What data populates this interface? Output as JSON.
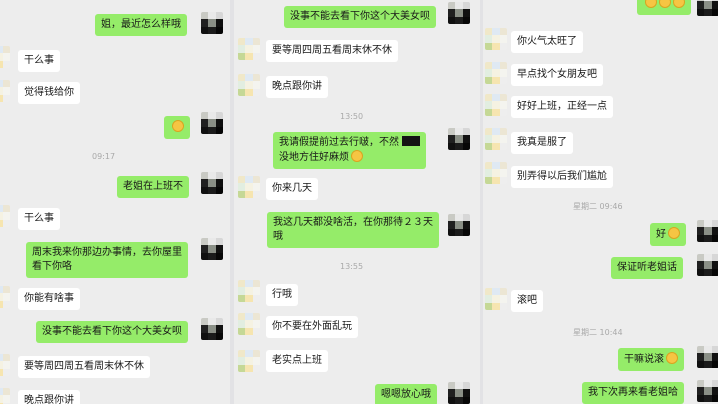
{
  "panel1": {
    "bubbles": [
      {
        "text": "姐，最近怎么样哦",
        "side": "right"
      },
      {
        "text": "干么事",
        "side": "left"
      },
      {
        "text": "觉得钱给你",
        "side": "left"
      },
      {
        "text": "",
        "side": "right",
        "emoji": true
      },
      {
        "text": "老姐在上班不",
        "side": "right"
      },
      {
        "text": "干么事",
        "side": "left"
      },
      {
        "text": "周末我来你那边办事情，去你屋里",
        "side": "right"
      },
      {
        "text": "看下你咯",
        "side": "right"
      },
      {
        "text": "你能有啥事",
        "side": "left"
      },
      {
        "text": "没事不能去看下你这个大美女呗",
        "side": "right"
      },
      {
        "text": "要等周四周五看周末休不休",
        "side": "left"
      },
      {
        "text": "晚点跟你讲",
        "side": "left"
      }
    ],
    "timestamps": [
      "09:17"
    ]
  },
  "panel2": {
    "bubbles": [
      {
        "text": "没事不能去看下你这个大美女呗",
        "side": "right"
      },
      {
        "text": "要等周四周五看周末休不休",
        "side": "left"
      },
      {
        "text": "晚点跟你讲",
        "side": "left"
      },
      {
        "text": "我请假提前过去行啵，不然",
        "side": "right"
      },
      {
        "text": "没地方住好麻烦",
        "side": "right"
      },
      {
        "text": "你来几天",
        "side": "left"
      },
      {
        "text": "我这几天都没啥活，在你那待２３天",
        "side": "right"
      },
      {
        "text": "哦",
        "side": "right"
      },
      {
        "text": "行哦",
        "side": "left"
      },
      {
        "text": "你不要在外面乱玩",
        "side": "left"
      },
      {
        "text": "老实点上班",
        "side": "left"
      },
      {
        "text": "嗯嗯放心哦",
        "side": "right"
      }
    ],
    "timestamps": [
      "13:50",
      "13:55"
    ]
  },
  "panel3": {
    "bubbles": [
      {
        "text": "你火气太旺了",
        "side": "left"
      },
      {
        "text": "早点找个女朋友吧",
        "side": "left"
      },
      {
        "text": "好好上班，正经一点",
        "side": "left"
      },
      {
        "text": "我真是服了",
        "side": "left"
      },
      {
        "text": "别弄得以后我们尴尬",
        "side": "left"
      },
      {
        "text": "好",
        "side": "right"
      },
      {
        "text": "保证听老姐话",
        "side": "right"
      },
      {
        "text": "滚吧",
        "side": "left"
      },
      {
        "text": "干嘛说滚",
        "side": "right"
      },
      {
        "text": "我下次再来看老姐哈",
        "side": "right"
      }
    ],
    "timestamps": [
      "星期二 09:46",
      "星期二 10:44"
    ]
  },
  "icons": [
    "avatar-mosaic",
    "emoji-icon"
  ],
  "colors": {
    "sent_bubble": "#95ec69",
    "received_bubble": "#ffffff",
    "chat_background": "#ededed",
    "timestamp": "#a9a9a9"
  }
}
